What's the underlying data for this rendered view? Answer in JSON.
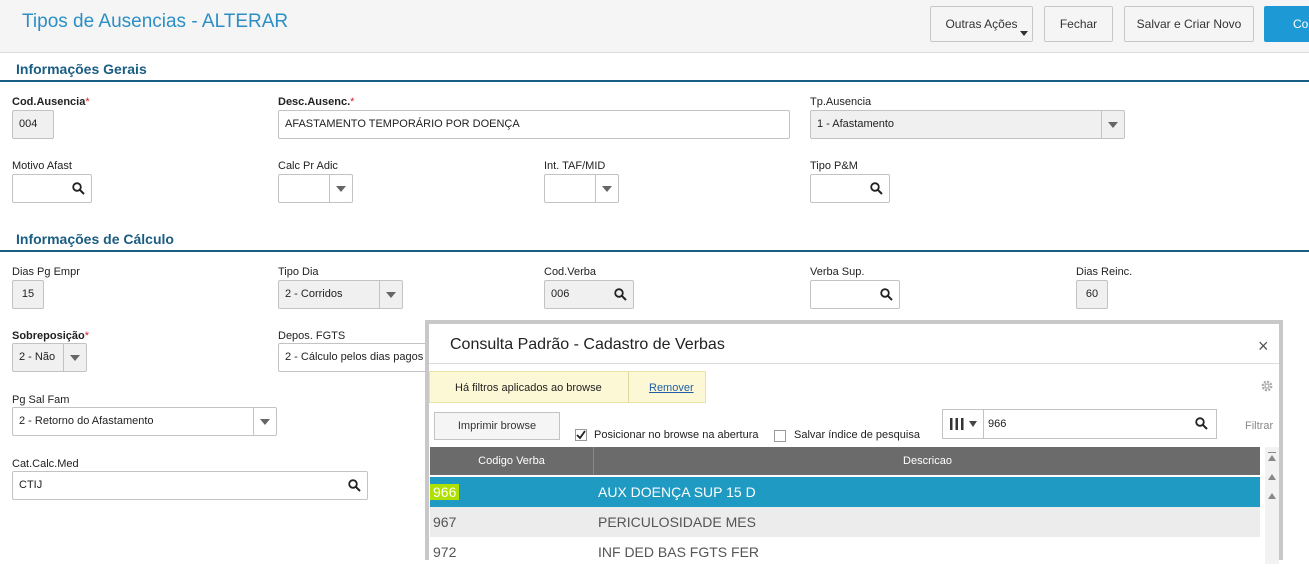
{
  "header": {
    "title": "Tipos de Ausencias - ALTERAR",
    "buttons": {
      "outras_acoes": "Outras Ações",
      "fechar": "Fechar",
      "salvar_criar": "Salvar e Criar Novo",
      "confirmar": "Confi"
    }
  },
  "sections": {
    "gerais": "Informações Gerais",
    "calculo": "Informações de Cálculo"
  },
  "required_mark": "*",
  "fields": {
    "cod_ausencia": {
      "label": "Cod.Ausencia",
      "value": "004"
    },
    "desc_ausenc": {
      "label": "Desc.Ausenc.",
      "value": "AFASTAMENTO TEMPORÁRIO POR DOENÇA"
    },
    "tp_ausencia": {
      "label": "Tp.Ausencia",
      "value": "1 - Afastamento"
    },
    "motivo_afast": {
      "label": "Motivo Afast",
      "value": ""
    },
    "calc_pr_adic": {
      "label": "Calc Pr Adic",
      "value": ""
    },
    "int_taf_mid": {
      "label": "Int. TAF/MID",
      "value": ""
    },
    "tipo_pm": {
      "label": "Tipo P&M",
      "value": ""
    },
    "dias_pg_empr": {
      "label": "Dias Pg Empr",
      "value": "15"
    },
    "tipo_dia": {
      "label": "Tipo Dia",
      "value": "2 - Corridos"
    },
    "cod_verba": {
      "label": "Cod.Verba",
      "value": "006"
    },
    "verba_sup": {
      "label": "Verba Sup.",
      "value": ""
    },
    "dias_reinc": {
      "label": "Dias Reinc.",
      "value": "60"
    },
    "sobreposicao": {
      "label": "Sobreposição",
      "value": "2 - Não"
    },
    "depos_fgts": {
      "label": "Depos. FGTS",
      "value": "2 - Cálculo pelos dias pagos"
    },
    "pg_sal_fam": {
      "label": "Pg Sal Fam",
      "value": "2 - Retorno do Afastamento"
    },
    "cat_calc_med": {
      "label": "Cat.Calc.Med",
      "value": "CTIJ"
    }
  },
  "dialog": {
    "title": "Consulta Padrão - Cadastro de Verbas",
    "close": "×",
    "filter_notice": "Há filtros aplicados ao browse",
    "remove": "Remover",
    "print_button": "Imprimir browse",
    "position_checkbox": {
      "label": "Posicionar no browse na abertura",
      "checked": true
    },
    "save_index_checkbox": {
      "label": "Salvar índice de pesquisa",
      "checked": false
    },
    "search_value": "966",
    "filter_link": "Filtrar",
    "columns": [
      "Codigo Verba",
      "Descricao"
    ],
    "rows": [
      {
        "code": "966",
        "desc": "AUX DOENÇA SUP 15 D",
        "selected": true
      },
      {
        "code": "967",
        "desc": "PERICULOSIDADE MES",
        "selected": false
      },
      {
        "code": "972",
        "desc": "INF DED BAS FGTS FER",
        "selected": false
      }
    ]
  },
  "colors": {
    "accent": "#2b8fc5",
    "section": "#1a5d82",
    "selected_row": "#1f9ac2",
    "search_highlight": "#aee000",
    "required": "#d4232b"
  }
}
